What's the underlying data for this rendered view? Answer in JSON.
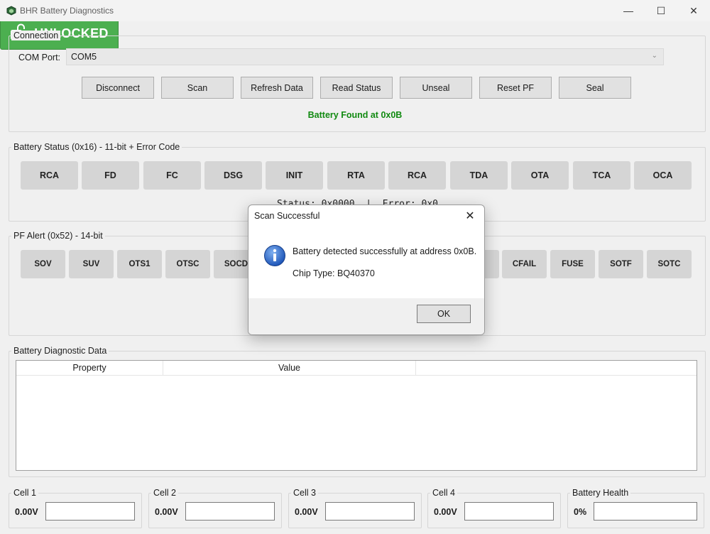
{
  "window": {
    "title": "BHR Battery Diagnostics",
    "icon": "battery-app-icon",
    "controls": {
      "minimize": "—",
      "maximize": "☐",
      "close": "✕"
    }
  },
  "connection": {
    "group_label": "Connection",
    "com_port_label": "COM Port:",
    "com_port_value": "COM5",
    "buttons": {
      "disconnect": "Disconnect",
      "scan": "Scan",
      "refresh_data": "Refresh Data",
      "read_status": "Read Status",
      "unseal": "Unseal",
      "reset_pf": "Reset PF",
      "seal": "Seal"
    },
    "found_message": "Battery Found at 0x0B",
    "found_color": "#118a11"
  },
  "battery_status": {
    "group_label": "Battery Status (0x16) - 11-bit + Error Code",
    "bits": [
      "RCA",
      "FD",
      "FC",
      "DSG",
      "INIT",
      "RTA",
      "RCA",
      "TDA",
      "OTA",
      "TCA",
      "OCA"
    ],
    "status_line": "Status: 0x0000  |  Error: 0x0"
  },
  "pf_alert": {
    "group_label": "PF Alert (0x52) - 14-bit",
    "bits_left": [
      "SOV",
      "SUV",
      "OTS1",
      "OTSC",
      "SOCD"
    ],
    "bits_right": [
      "CFAIL",
      "FUSE",
      "SOTF",
      "SOTC"
    ],
    "lock_state_label": "UNLOCKED",
    "lock_state_color": "#4caf50",
    "lock_icon": "unlocked-padlock-icon"
  },
  "diagnostic": {
    "group_label": "Battery Diagnostic Data",
    "columns": [
      "Property",
      "Value"
    ]
  },
  "cells": [
    {
      "label": "Cell 1",
      "value": "0.00V"
    },
    {
      "label": "Cell 2",
      "value": "0.00V"
    },
    {
      "label": "Cell 3",
      "value": "0.00V"
    },
    {
      "label": "Cell 4",
      "value": "0.00V"
    },
    {
      "label": "Battery Health",
      "value": "0%"
    }
  ],
  "dialog": {
    "title": "Scan Successful",
    "message": "Battery detected successfully at address 0x0B.",
    "chip_type": "Chip Type: BQ40370",
    "ok_label": "OK",
    "icon": "information-icon"
  }
}
